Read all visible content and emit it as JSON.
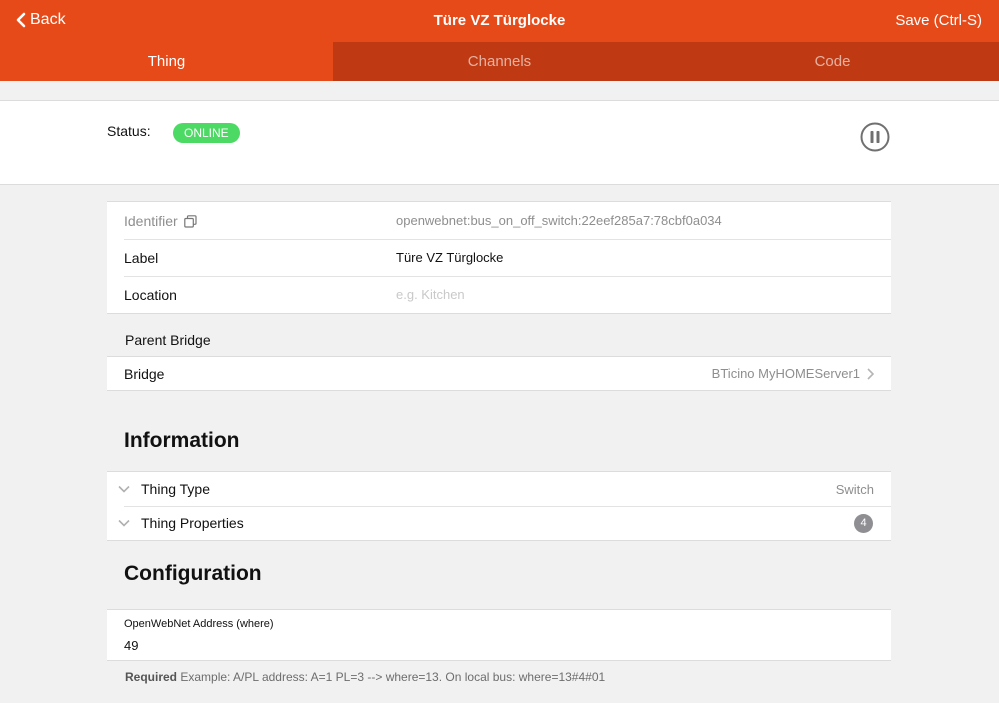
{
  "topbar": {
    "back_label": "Back",
    "title": "Türe VZ Türglocke",
    "save_label": "Save (Ctrl-S)"
  },
  "tabs": [
    {
      "label": "Thing",
      "active": true
    },
    {
      "label": "Channels",
      "active": false
    },
    {
      "label": "Code",
      "active": false
    }
  ],
  "status": {
    "label": "Status:",
    "value": "ONLINE",
    "color": "#4cd964"
  },
  "details": {
    "identifier_label": "Identifier",
    "identifier_value": "openwebnet:bus_on_off_switch:22eef285a7:78cbf0a034",
    "label_label": "Label",
    "label_value": "Türe VZ Türglocke",
    "location_label": "Location",
    "location_placeholder": "e.g. Kitchen"
  },
  "parent_bridge": {
    "heading": "Parent Bridge",
    "bridge_label": "Bridge",
    "bridge_value": "BTicino MyHOMEServer1"
  },
  "information": {
    "title": "Information",
    "thing_type_label": "Thing Type",
    "thing_type_value": "Switch",
    "thing_properties_label": "Thing Properties",
    "thing_properties_count": "4"
  },
  "configuration": {
    "title": "Configuration",
    "address_label": "OpenWebNet Address (where)",
    "address_value": "49",
    "required_label": "Required",
    "hint_text": " Example: A/PL address: A=1 PL=3 --> where=13. On local bus: where=13#4#01"
  },
  "colors": {
    "accent": "#e64a19",
    "tab_bar": "#bf3a13",
    "online": "#4cd964"
  },
  "icons": [
    "chevron-left-icon",
    "pause-icon",
    "copy-icon",
    "chevron-right-icon",
    "chevron-down-icon"
  ]
}
